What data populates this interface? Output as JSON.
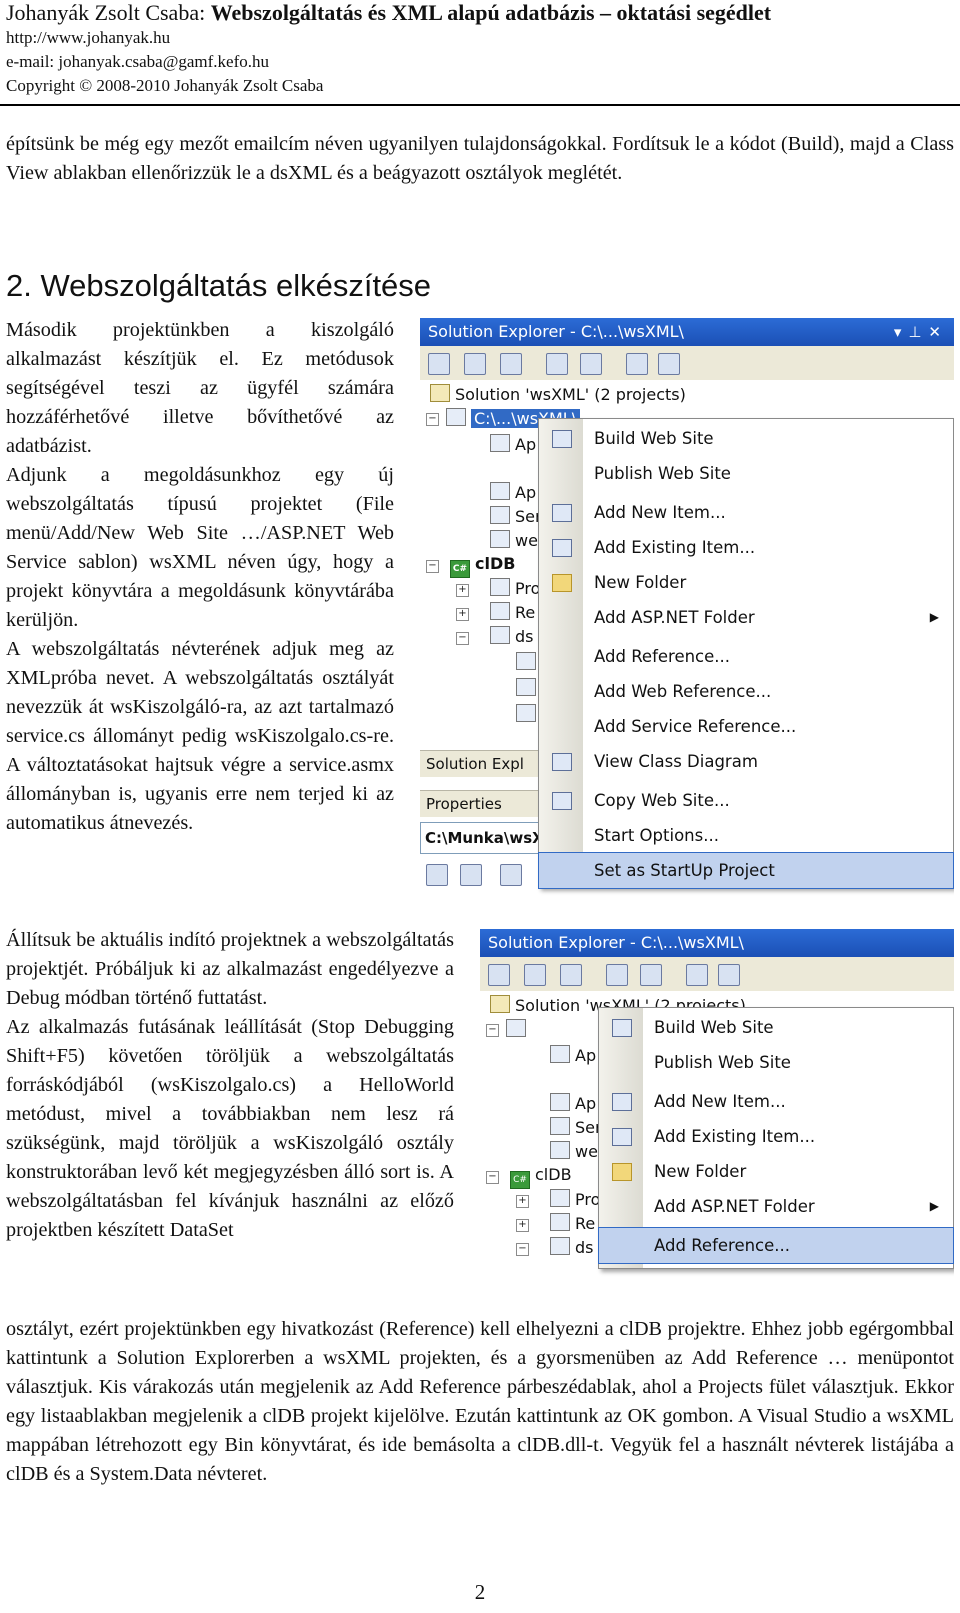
{
  "header": {
    "author": "Johanyák Zsolt Csaba:",
    "title": "Webszolgáltatás és XML alapú adatbázis – oktatási segédlet",
    "url": "http://www.johanyak.hu",
    "email": "e-mail: johanyak.csaba@gamf.kefo.hu",
    "copyright": "Copyright © 2008-2010 Johanyák Zsolt Csaba"
  },
  "intro_paragraph": "építsünk be még egy mezőt emailcím néven ugyanilyen tulajdonságokkal. Fordítsuk le a kódot (Build), majd a Class View ablakban ellenőrizzük le a dsXML és a beágyazott osztályok meglétét.",
  "section_heading": "2. Webszolgáltatás elkészítése",
  "left_column": [
    "Második projektünkben a kiszolgáló alkalmazást készítjük el. Ez metódusok segítségével teszi az ügyfél számára hozzáférhetővé illetve bővíthetővé az adatbázist.",
    "Adjunk a megoldásunkhoz egy új webszolgáltatás típusú projektet (File menü/Add/New Web Site …/ASP.NET Web Service sablon) wsXML néven úgy, hogy a projekt könyvtára a megoldásunk könyvtárába kerüljön.",
    "A webszolgáltatás névterének adjuk meg az XMLpróba nevet. A webszolgáltatás osztályát nevezzük át wsKiszolgáló-ra, az azt tartalmazó service.cs állományt pedig wsKiszolgalo.cs-re. A változtatásokat hajtsuk végre a service.asmx állományban is, ugyanis erre nem terjed ki az automatikus átnevezés."
  ],
  "left_column_2": [
    "Állítsuk be aktuális indító projektnek a webszolgáltatás projektjét. Próbáljuk ki az alkalmazást engedélyezve a Debug módban történő futtatást.",
    "Az alkalmazás futásának leállítását (Stop Debugging Shift+F5) követően töröljük a webszolgáltatás forráskódjából (wsKiszolgalo.cs) a HelloWorld metódust, mivel a továbbiakban nem lesz rá szükségünk, majd töröljük a wsKiszolgáló osztály konstruktorában levő két megjegyzésben álló sort is. A webszolgáltatásban fel kívánjuk használni az előző projektben készített DataSet"
  ],
  "full_paragraph": "osztályt, ezért projektünkben egy hivatkozást (Reference) kell elhelyezni a clDB projektre. Ehhez jobb egérgombbal kattintunk a Solution Explorerben a wsXML projekten, és a gyorsmenüben az Add Reference … menüpontot választjuk. Kis várakozás után megjelenik az Add Reference párbeszédablak, ahol a Projects fület választjuk. Ekkor egy listaablakban megjelenik a clDB projekt kijelölve. Ezután kattintunk az OK gombon. A Visual Studio a wsXML mappában létrehozott egy Bin könyvtárat, és ide bemásolta a clDB.dll-t. Vegyük fel a használt névterek listájába a clDB és a System.Data névteret.",
  "page_number": "2",
  "screenshot1": {
    "title": "Solution Explorer - C:\\...\\wsXML\\",
    "solution_label": "Solution 'wsXML' (2 projects)",
    "selected_node": "C:\\...\\wsXML\\",
    "tree_partial": [
      "Ap",
      "Ap",
      "Ser",
      "we",
      "clDB",
      "Pro",
      "Re",
      "ds"
    ],
    "bottom_tab": "Solution Expl",
    "properties_label": "Properties",
    "properties_value": "C:\\Munka\\wsX",
    "menu_items": [
      {
        "label": "Build Web Site",
        "icon": "build-icon"
      },
      {
        "label": "Publish Web Site",
        "icon": ""
      },
      {
        "label": "Add New Item...",
        "icon": "add-new-item-icon"
      },
      {
        "label": "Add Existing Item...",
        "icon": "add-existing-item-icon"
      },
      {
        "label": "New Folder",
        "icon": "folder-icon"
      },
      {
        "label": "Add ASP.NET Folder",
        "icon": "",
        "submenu": true
      },
      {
        "label": "Add Reference...",
        "icon": ""
      },
      {
        "label": "Add Web Reference...",
        "icon": ""
      },
      {
        "label": "Add Service Reference...",
        "icon": ""
      },
      {
        "label": "View Class Diagram",
        "icon": "class-diagram-icon"
      },
      {
        "label": "Copy Web Site...",
        "icon": "copy-web-site-icon"
      },
      {
        "label": "Start Options...",
        "icon": ""
      },
      {
        "label": "Set as StartUp Project",
        "icon": "",
        "highlighted": true
      }
    ]
  },
  "screenshot2": {
    "title": "Solution Explorer - C:\\...\\wsXML\\",
    "solution_label": "Solution 'wsXML' (2 projects)",
    "tree_partial": [
      "Ap",
      "Ap",
      "Ser",
      "we",
      "clDB",
      "Pro",
      "Re",
      "ds"
    ],
    "menu_items": [
      {
        "label": "Build Web Site",
        "icon": "build-icon"
      },
      {
        "label": "Publish Web Site",
        "icon": ""
      },
      {
        "label": "Add New Item...",
        "icon": "add-new-item-icon"
      },
      {
        "label": "Add Existing Item...",
        "icon": "add-existing-item-icon"
      },
      {
        "label": "New Folder",
        "icon": "folder-icon"
      },
      {
        "label": "Add ASP.NET Folder",
        "icon": "",
        "submenu": true
      },
      {
        "label": "Add Reference...",
        "icon": "",
        "highlighted": true
      }
    ]
  },
  "colors": {
    "titlebar": "#2c6cd6",
    "selection": "#316ac5",
    "menu_highlight": "#c1d2ee"
  }
}
